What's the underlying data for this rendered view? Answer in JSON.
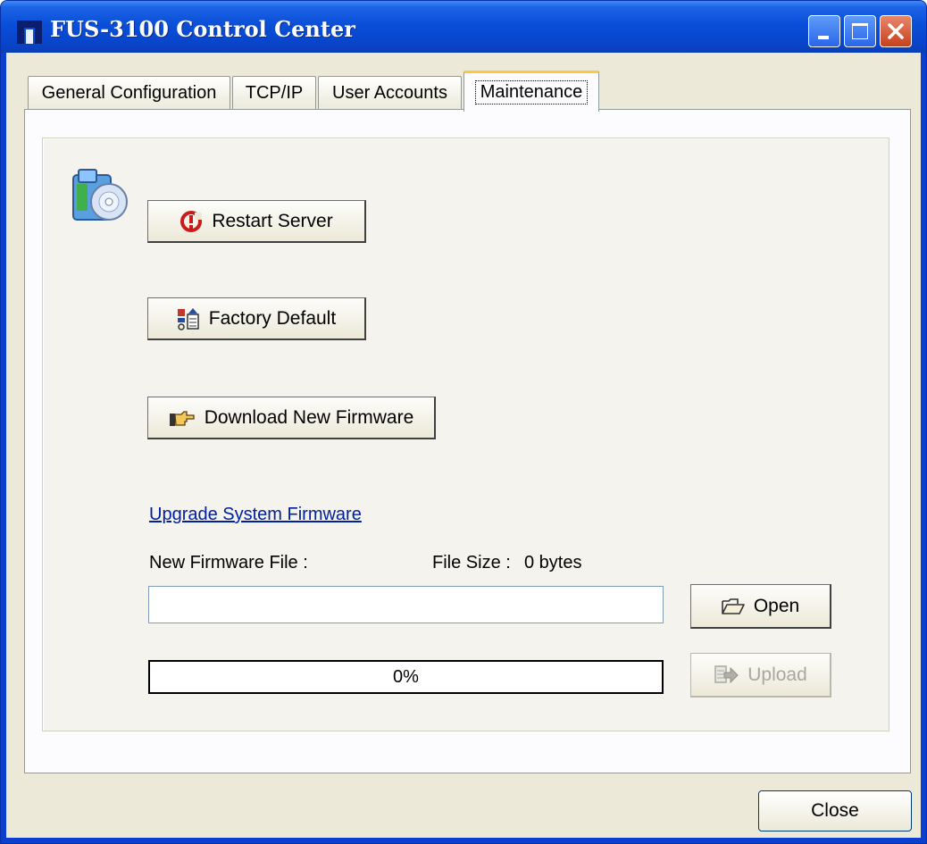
{
  "window": {
    "title": "FUS-3100 Control Center",
    "icon": "app-logo-icon",
    "controls": [
      "minimize-icon",
      "maximize-icon",
      "close-icon"
    ]
  },
  "tabs": [
    {
      "label": "General Configuration",
      "selected": false
    },
    {
      "label": "TCP/IP",
      "selected": false
    },
    {
      "label": "User Accounts",
      "selected": false
    },
    {
      "label": "Maintenance",
      "selected": true
    }
  ],
  "maintenance": {
    "icon": "maintenance-cd-icon",
    "restart_button": {
      "label": "Restart Server",
      "icon": "restart-icon"
    },
    "factory_default_button": {
      "label": "Factory Default",
      "icon": "factory-default-icon"
    },
    "download_button": {
      "label": "Download New Firmware",
      "icon": "hand-pointer-icon"
    },
    "upgrade_link": "Upgrade System Firmware",
    "firmware_file_label": "New Firmware File :",
    "file_size_label": "File Size :",
    "file_size_value": "0 bytes",
    "file_path_value": "",
    "open_button": {
      "label": "Open",
      "icon": "open-folder-icon"
    },
    "progress": {
      "percent": 0,
      "text": "0%"
    },
    "upload_button": {
      "label": "Upload",
      "icon": "upload-icon",
      "enabled": false
    }
  },
  "footer": {
    "close_button": "Close"
  },
  "colors": {
    "titlebar": "#0a4fd8",
    "face": "#ece9d8",
    "tab_highlight": "#ffc83c",
    "link": "#0020a0",
    "close_control": "#c6411c"
  }
}
